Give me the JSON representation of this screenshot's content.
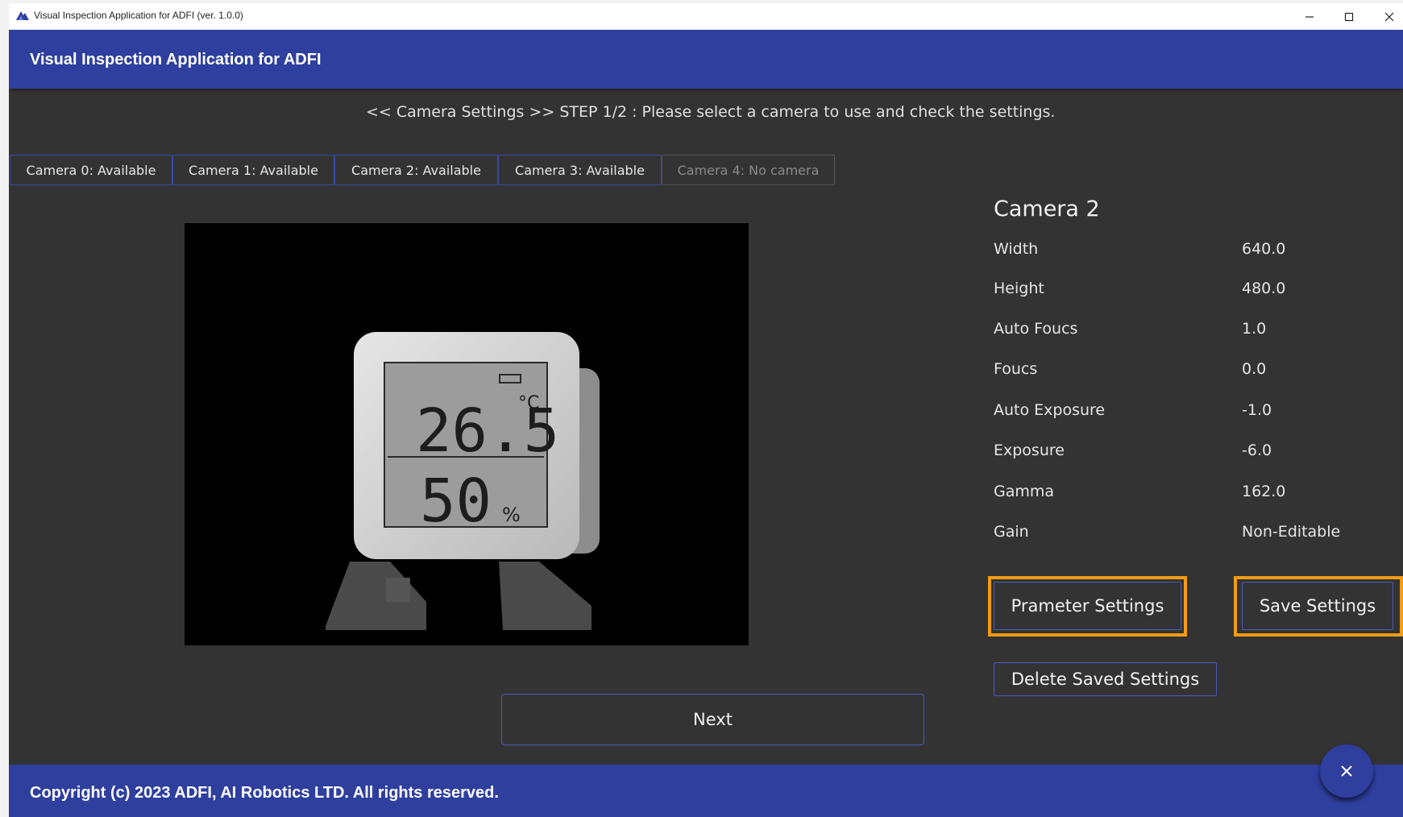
{
  "window": {
    "title": "Visual Inspection Application for ADFI (ver. 1.0.0)",
    "minimize_icon": "minimize-icon",
    "maximize_icon": "maximize-icon",
    "close_icon": "close-icon"
  },
  "header": {
    "title": "Visual Inspection Application for ADFI"
  },
  "step": {
    "text": "<< Camera Settings >>  STEP 1/2 :  Please select a camera to use and check the settings."
  },
  "tabs": [
    {
      "label": "Camera 0: Available",
      "enabled": true
    },
    {
      "label": "Camera 1: Available",
      "enabled": true
    },
    {
      "label": "Camera 2: Available",
      "enabled": true
    },
    {
      "label": "Camera 3: Available",
      "enabled": true
    },
    {
      "label": "Camera 4: No camera",
      "enabled": false
    }
  ],
  "preview": {
    "display_temp": "26.5",
    "temp_unit": "°C",
    "display_humidity": "50",
    "humidity_unit": "%"
  },
  "camera": {
    "title": "Camera 2",
    "settings": [
      {
        "label": "Width",
        "value": "640.0"
      },
      {
        "label": "Height",
        "value": "480.0"
      },
      {
        "label": "Auto Foucs",
        "value": "1.0"
      },
      {
        "label": "Foucs",
        "value": "0.0"
      },
      {
        "label": "Auto Exposure",
        "value": "-1.0"
      },
      {
        "label": "Exposure",
        "value": "-6.0"
      },
      {
        "label": "Gamma",
        "value": "162.0"
      },
      {
        "label": "Gain",
        "value": "Non-Editable"
      }
    ]
  },
  "buttons": {
    "parameter_settings": "Prameter Settings",
    "save_settings": "Save Settings",
    "delete_saved_settings": "Delete Saved Settings",
    "next": "Next",
    "fab_icon": "close-icon"
  },
  "highlight_color": "#f39c12",
  "accent_color": "#2e3f9e",
  "footer": {
    "copyright": "Copyright (c) 2023 ADFI, AI Robotics LTD. All rights reserved."
  }
}
